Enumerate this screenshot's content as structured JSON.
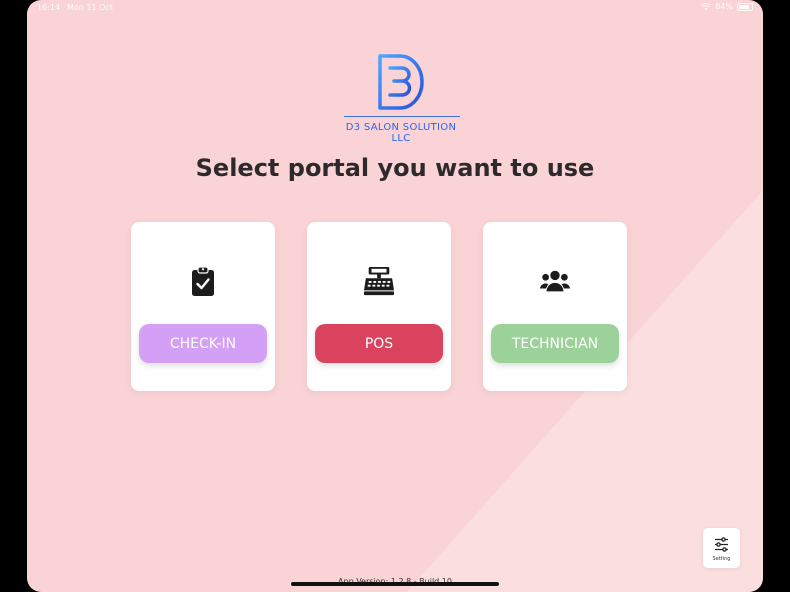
{
  "status": {
    "time": "16:14",
    "date": "Mon 11 Oct",
    "battery": "84%"
  },
  "logo": {
    "mark": "D3",
    "company": "D3 SALON SOLUTION LLC",
    "accent": "#2a66e8"
  },
  "title": "Select portal you want to use",
  "portals": [
    {
      "label": "CHECK-IN",
      "icon": "clipboard-check-icon",
      "color": "#d4a0f5"
    },
    {
      "label": "POS",
      "icon": "cash-register-icon",
      "color": "#d9435d"
    },
    {
      "label": "TECHNICIAN",
      "icon": "users-icon",
      "color": "#9dd19a"
    }
  ],
  "setting": {
    "label": "Setting",
    "icon": "sliders-icon"
  },
  "version": "App Version: 1.2.8 - Build 10"
}
